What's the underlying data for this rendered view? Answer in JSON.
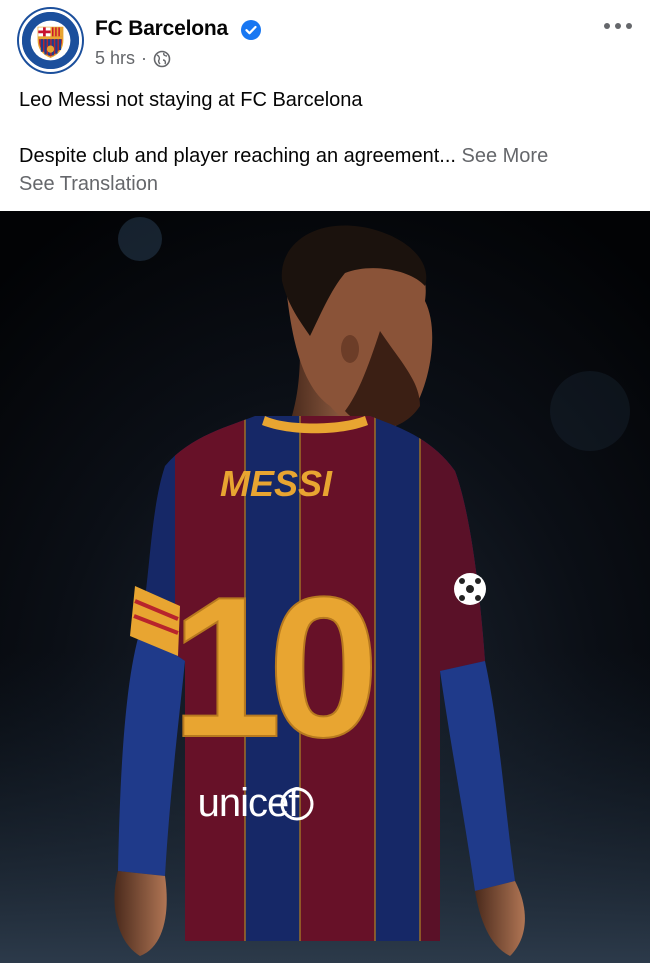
{
  "post": {
    "author": "FC Barcelona",
    "verified": true,
    "time": "5 hrs",
    "separator": "·",
    "privacy_icon": "globe-icon",
    "options_icon": "more-options-icon",
    "headline": "Leo Messi not staying at FC Barcelona",
    "body": "Despite club and player reaching an agreement...",
    "see_more": "See More",
    "see_translation": "See Translation"
  },
  "photo": {
    "shirt_name": "MESSI",
    "shirt_number": "10",
    "sponsor": "unicef",
    "colors": {
      "blue": "#1a2f7a",
      "garnet": "#7a1530",
      "gold": "#e8a531",
      "background": "#05070c"
    }
  },
  "colors": {
    "text": "#050505",
    "secondary": "#65676b",
    "verified": "#1877f2"
  }
}
